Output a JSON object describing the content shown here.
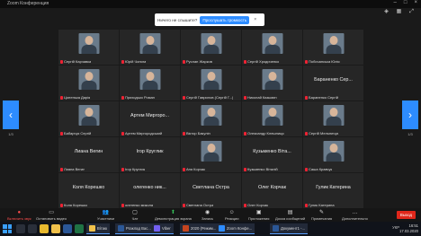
{
  "window": {
    "title": "Zoom Конференция"
  },
  "prompt": {
    "question": "Ничего не слышите?",
    "action": "Прослушать громкость",
    "close": "×"
  },
  "pager": {
    "left": "1/3",
    "right": "1/3"
  },
  "participants": [
    {
      "label": "Сергій Карчавка",
      "display": "avatar"
    },
    {
      "label": "Юрій Чопига",
      "display": "avatar"
    },
    {
      "label": "Руслан Жарков",
      "display": "avatar"
    },
    {
      "label": "Сергій Хродиченко",
      "display": "avatar"
    },
    {
      "label": "Побочанська Юлія",
      "display": "avatar"
    },
    {
      "label": "Цопенька Дарія",
      "display": "avatar"
    },
    {
      "label": "Приходько Роман",
      "display": "avatar"
    },
    {
      "label": "Сергій Гаврилов (Сергій Г...)",
      "display": "avatar"
    },
    {
      "label": "Николай Казьмин",
      "display": "avatar"
    },
    {
      "label": "Бараненко Сергій",
      "display": "name",
      "big": "Бараненко Сер..."
    },
    {
      "label": "Бабарчук Сергій",
      "display": "avatar"
    },
    {
      "label": "Артем Миргородський",
      "display": "name",
      "big": "Артем Миргоро..."
    },
    {
      "label": "Віктор Бакулін",
      "display": "avatar"
    },
    {
      "label": "Олександр Клешниця",
      "display": "avatar"
    },
    {
      "label": "Сергій Мельничук",
      "display": "avatar"
    },
    {
      "label": "Лиана Вегин",
      "display": "name",
      "big": "Лиана Вегин"
    },
    {
      "label": "Ігор Круглик",
      "display": "name",
      "big": "Ігор Круглик"
    },
    {
      "label": "Аня Корчак",
      "display": "avatar"
    },
    {
      "label": "Кузьменко Віталій",
      "display": "name",
      "big": "Кузьменко Вітa..."
    },
    {
      "label": "Саша Кравчук",
      "display": "avatar"
    },
    {
      "label": "Коля Корешко",
      "display": "name",
      "big": "Коля Корешко"
    },
    {
      "label": "олегенко микола",
      "display": "name",
      "big": "олегенко ник..."
    },
    {
      "label": "Светлана Остра",
      "display": "name",
      "big": "Светлана Остра"
    },
    {
      "label": "Олег Корчак",
      "display": "name",
      "big": "Олег Корчак"
    },
    {
      "label": "Гулик Катерина",
      "display": "name",
      "big": "Гулик Катерина"
    }
  ],
  "toolbar": {
    "mute": "Включить звук",
    "video": "Остановить видео",
    "participants": "Участники",
    "participants_count": "54",
    "chat": "Чат",
    "share": "Демонстрация экрана",
    "record": "Запись",
    "reactions": "Реакции",
    "apps": "Приложения",
    "whiteboard": "Доска сообщений",
    "notes": "Примечания",
    "more": "Дополнительно",
    "end": "Выход"
  },
  "taskbar": {
    "tasks": [
      {
        "label": "Вітаю"
      },
      {
        "label": "Розклад Вас..."
      },
      {
        "label": "Viber"
      },
      {
        "label": "2020 (Режим..."
      },
      {
        "label": "Zoom Конфе..."
      },
      {
        "label": "Документ1 -..."
      }
    ],
    "tray": "УКР",
    "time": "16:51",
    "date": "17.03.2020"
  },
  "colors": {
    "accent": "#2d8cff",
    "end": "#e0271b",
    "tile": "#262626"
  }
}
